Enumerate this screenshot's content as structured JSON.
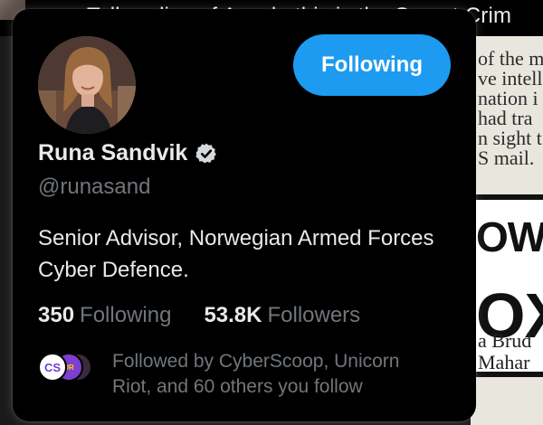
{
  "background": {
    "headline": "Talk radio sof Assala this is the Secret Crim",
    "newspaper_lines": [
      "of the m",
      "ve intell",
      "nation i",
      "had tra",
      "n sight t",
      "S mail."
    ],
    "newspaper_big_top": "OWD",
    "newspaper_big_bottom": "OX",
    "newspaper_footer": [
      "a Brud",
      "Mahar"
    ]
  },
  "profile": {
    "name": "Runa Sandvik",
    "handle": "@runasand",
    "bio": "Senior Advisor, Norwegian Armed Forces Cyber Defence.",
    "verified_icon": "verified-badge-icon",
    "follow_button_label": "Following",
    "following_count": "350",
    "following_label": "Following",
    "followers_count": "53.8K",
    "followers_label": "Followers",
    "followed_by_text": "Followed by CyberScoop, Unicorn Riot, and 60 others you follow",
    "mutual_avatars": [
      "CS",
      "UR",
      ""
    ]
  },
  "colors": {
    "accent": "#1d9bf0",
    "card_bg": "#000000",
    "primary_text": "#e7e9ea",
    "secondary_text": "#71767b"
  }
}
